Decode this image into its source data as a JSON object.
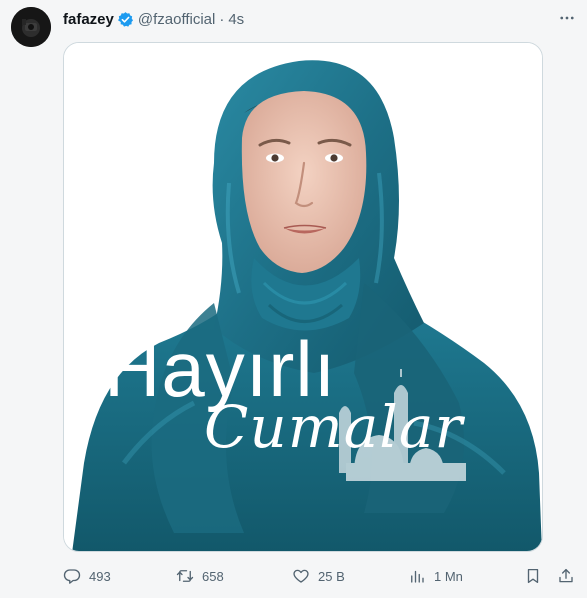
{
  "tweet": {
    "author": {
      "display_name": "fafazey",
      "handle": "@fzaofficial",
      "verified": true,
      "avatar_icon": "avatar-image"
    },
    "separator": "·",
    "time": "4s",
    "more_icon": "more-icon",
    "media": {
      "overlay_line1": "Hayırlı",
      "overlay_line2": "Cumalar"
    },
    "actions": {
      "replies": "493",
      "retweets": "658",
      "likes": "25 B",
      "views": "1 Mn"
    }
  },
  "colors": {
    "background": "#f5f6f7",
    "text_primary": "#0f1419",
    "text_secondary": "#536471",
    "verified_blue": "#1d9bf0",
    "hijab_teal": "#1f7288"
  }
}
